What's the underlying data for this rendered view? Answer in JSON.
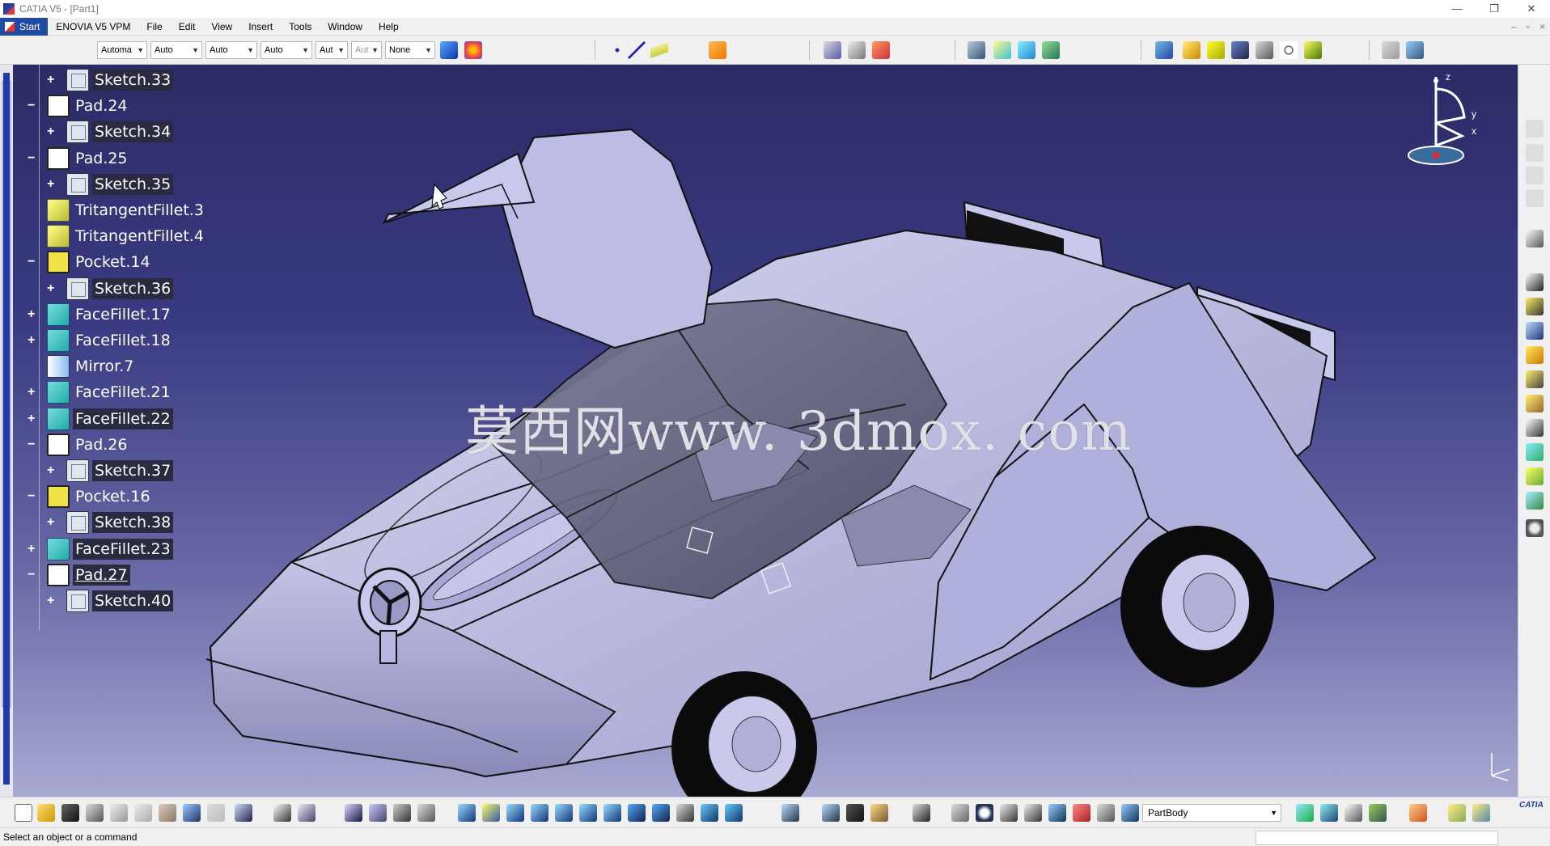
{
  "window": {
    "title": "CATIA V5 - [Part1]",
    "controls": [
      "—",
      "❐",
      "✕"
    ],
    "doc_controls": [
      "–",
      "▫",
      "×"
    ]
  },
  "menu": {
    "start": "Start",
    "items": [
      "ENOVIA V5 VPM",
      "File",
      "Edit",
      "View",
      "Insert",
      "Tools",
      "Window",
      "Help"
    ]
  },
  "toolbar": {
    "combos": [
      "Automa",
      "Auto",
      "Auto",
      "Auto",
      "Aut",
      "Aut",
      "None"
    ]
  },
  "spec_tree": {
    "items": [
      {
        "label": "Sketch.33",
        "icon": "sketch-icon",
        "expander": "+"
      },
      {
        "label": "Pad.24",
        "icon": "pad-icon",
        "expander": "−"
      },
      {
        "label": "Sketch.34",
        "icon": "sketch-icon",
        "expander": "+"
      },
      {
        "label": "Pad.25",
        "icon": "pad-icon",
        "expander": "−"
      },
      {
        "label": "Sketch.35",
        "icon": "sketch-icon",
        "expander": "+"
      },
      {
        "label": "TritangentFillet.3",
        "icon": "tritangent-fillet-icon",
        "expander": ""
      },
      {
        "label": "TritangentFillet.4",
        "icon": "tritangent-fillet-icon",
        "expander": ""
      },
      {
        "label": "Pocket.14",
        "icon": "pocket-icon",
        "expander": "−"
      },
      {
        "label": "Sketch.36",
        "icon": "sketch-icon",
        "expander": "+"
      },
      {
        "label": "FaceFillet.17",
        "icon": "face-fillet-icon",
        "expander": "+"
      },
      {
        "label": "FaceFillet.18",
        "icon": "face-fillet-icon",
        "expander": "+"
      },
      {
        "label": "Mirror.7",
        "icon": "mirror-icon",
        "expander": ""
      },
      {
        "label": "FaceFillet.21",
        "icon": "face-fillet-icon",
        "expander": "+"
      },
      {
        "label": "FaceFillet.22",
        "icon": "face-fillet-icon",
        "expander": "+"
      },
      {
        "label": "Pad.26",
        "icon": "pad-icon",
        "expander": "−"
      },
      {
        "label": "Sketch.37",
        "icon": "sketch-icon",
        "expander": "+"
      },
      {
        "label": "Pocket.16",
        "icon": "pocket-icon",
        "expander": "−"
      },
      {
        "label": "Sketch.38",
        "icon": "sketch-icon",
        "expander": "+"
      },
      {
        "label": "FaceFillet.23",
        "icon": "face-fillet-icon",
        "expander": "+"
      },
      {
        "label": "Pad.27",
        "icon": "pad-icon",
        "expander": "−"
      },
      {
        "label": "Sketch.40",
        "icon": "sketch-icon",
        "expander": "+"
      }
    ]
  },
  "viewport": {
    "watermark": "莫西网www. 3dmox. com",
    "compass_axes": [
      "z",
      "y",
      "x"
    ]
  },
  "bottom": {
    "body_selector": "PartBody",
    "logo": "CATIA"
  },
  "status": {
    "message": "Select an object or a command"
  },
  "colors": {
    "viewport_top": "#2b2b66",
    "viewport_bottom": "#a9a9d2",
    "part_surface": "#b9b9e2",
    "start_button": "#1f4ba0"
  }
}
